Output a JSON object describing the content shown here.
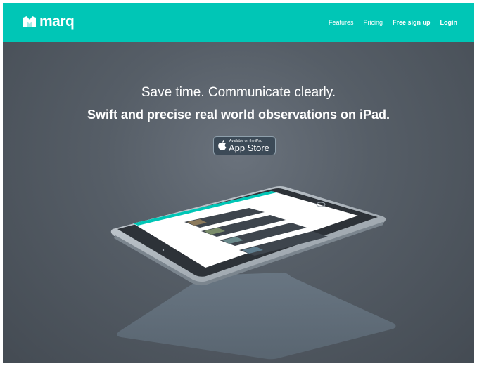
{
  "brand": {
    "name": "marq",
    "accent_color": "#00c6b6"
  },
  "nav": {
    "links": [
      {
        "label": "Features"
      },
      {
        "label": "Pricing"
      },
      {
        "label": "Free sign up"
      },
      {
        "label": "Login"
      }
    ]
  },
  "hero": {
    "headline": "Save time. Communicate clearly.",
    "subheadline": "Swift and precise real world observations on iPad.",
    "appstore": {
      "small_text": "Available on the iPad",
      "big_text": "App Store",
      "icon": "apple-icon"
    }
  },
  "device": {
    "type": "ipad-mockup"
  }
}
